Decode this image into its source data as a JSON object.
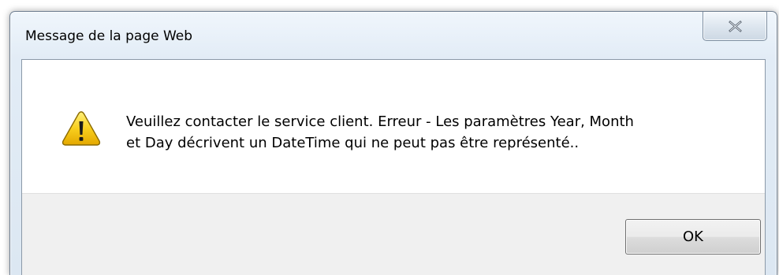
{
  "dialog": {
    "title": "Message de la page Web",
    "close_icon": "close-icon",
    "warning_icon": "warning-icon",
    "message_lines": [
      "Veuillez contacter le service client. Erreur - Les paramètres Year, Month",
      "et Day décrivent un DateTime qui ne peut pas être représenté.."
    ],
    "ok_label": "OK"
  },
  "colors": {
    "title_bar": "#dce7f2",
    "content_background": "#ffffff",
    "footer_background": "#f0f0f0",
    "warning_yellow": "#f5c400"
  }
}
